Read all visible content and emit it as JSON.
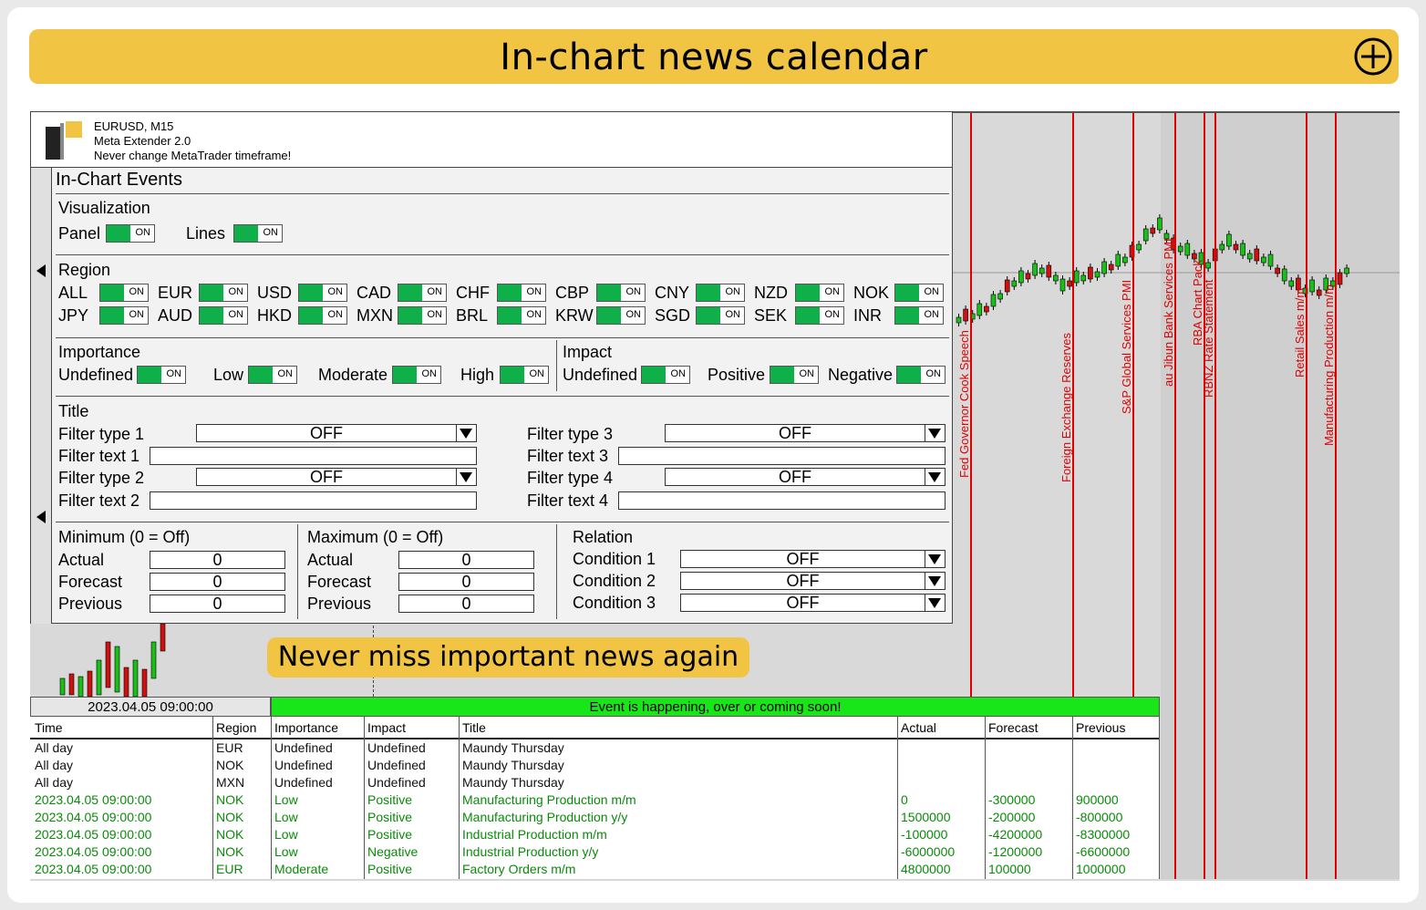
{
  "banner": {
    "title": "In-chart news calendar"
  },
  "header": {
    "line1": "EURUSD, M15",
    "line2": "Meta Extender 2.0",
    "line3": "Never change MetaTrader timeframe!"
  },
  "panel": {
    "title": "In-Chart Events",
    "visualization": {
      "label": "Visualization",
      "panel_label": "Panel",
      "lines_label": "Lines"
    },
    "toggle_text": "ON",
    "region": {
      "label": "Region",
      "row1": [
        "ALL",
        "EUR",
        "USD",
        "CAD",
        "CHF",
        "CBP",
        "CNY",
        "NZD",
        "NOK"
      ],
      "row2": [
        "JPY",
        "AUD",
        "HKD",
        "MXN",
        "BRL",
        "KRW",
        "SGD",
        "SEK",
        "INR"
      ]
    },
    "importance": {
      "label": "Importance",
      "items": [
        "Undefined",
        "Low",
        "Moderate",
        "High"
      ]
    },
    "impact": {
      "label": "Impact",
      "items": [
        "Undefined",
        "Positive",
        "Negative"
      ]
    },
    "title_filter": {
      "label": "Title",
      "filter_type_1": "Filter type 1",
      "filter_text_1": "Filter text 1",
      "filter_type_2": "Filter type 2",
      "filter_text_2": "Filter text 2",
      "filter_type_3": "Filter type 3",
      "filter_text_3": "Filter text 3",
      "filter_type_4": "Filter type 4",
      "filter_text_4": "Filter text 4",
      "value": "OFF"
    },
    "minimum": {
      "label": "Minimum (0 = Off)",
      "actual": "Actual",
      "forecast": "Forecast",
      "previous": "Previous",
      "value": "0"
    },
    "maximum": {
      "label": "Maximum (0 = Off)",
      "actual": "Actual",
      "forecast": "Forecast",
      "previous": "Previous",
      "value": "0"
    },
    "relation": {
      "label": "Relation",
      "c1": "Condition 1",
      "c2": "Condition 2",
      "c3": "Condition 3",
      "value": "OFF"
    }
  },
  "chart_events": [
    "Fed Governor Cook Speech",
    "Foreign Exchange Reserves",
    "S&P Global Services PMI",
    "au Jibun Bank Services PMI",
    "RBA Chart Pack",
    "RBNZ Rate Statement",
    "Retail Sales m/m",
    "Manufacturing Production m/m"
  ],
  "cta": "Never miss important news again",
  "datebar": "2023.04.05 09:00:00",
  "eventbar": "Event is happening, over or coming soon!",
  "colors": {
    "accent": "#f2c444",
    "toggle_on": "#0fb04a",
    "event_bar": "#19e619",
    "event_line": "#e00000",
    "green_text": "#0a8a0a"
  },
  "table": {
    "headers": [
      "Time",
      "Region",
      "Importance",
      "Impact",
      "Title",
      "Actual",
      "Forecast",
      "Previous"
    ],
    "rows": [
      [
        "All day",
        "EUR",
        "Undefined",
        "Undefined",
        "Maundy Thursday",
        "",
        "",
        ""
      ],
      [
        "All day",
        "NOK",
        "Undefined",
        "Undefined",
        "Maundy Thursday",
        "",
        "",
        ""
      ],
      [
        "All day",
        "MXN",
        "Undefined",
        "Undefined",
        "Maundy Thursday",
        "",
        "",
        ""
      ],
      [
        "2023.04.05 09:00:00",
        "NOK",
        "Low",
        "Positive",
        "Manufacturing Production m/m",
        "0",
        "-300000",
        "900000"
      ],
      [
        "2023.04.05 09:00:00",
        "NOK",
        "Low",
        "Positive",
        "Manufacturing Production y/y",
        "1500000",
        "-200000",
        "-800000"
      ],
      [
        "2023.04.05 09:00:00",
        "NOK",
        "Low",
        "Positive",
        "Industrial Production m/m",
        "-100000",
        "-4200000",
        "-8300000"
      ],
      [
        "2023.04.05 09:00:00",
        "NOK",
        "Low",
        "Negative",
        "Industrial Production y/y",
        "-6000000",
        "-1200000",
        "-6600000"
      ],
      [
        "2023.04.05 09:00:00",
        "EUR",
        "Moderate",
        "Positive",
        "Factory Orders m/m",
        "4800000",
        "100000",
        "1000000"
      ]
    ],
    "row_green": [
      false,
      false,
      false,
      true,
      true,
      true,
      true,
      true
    ]
  }
}
